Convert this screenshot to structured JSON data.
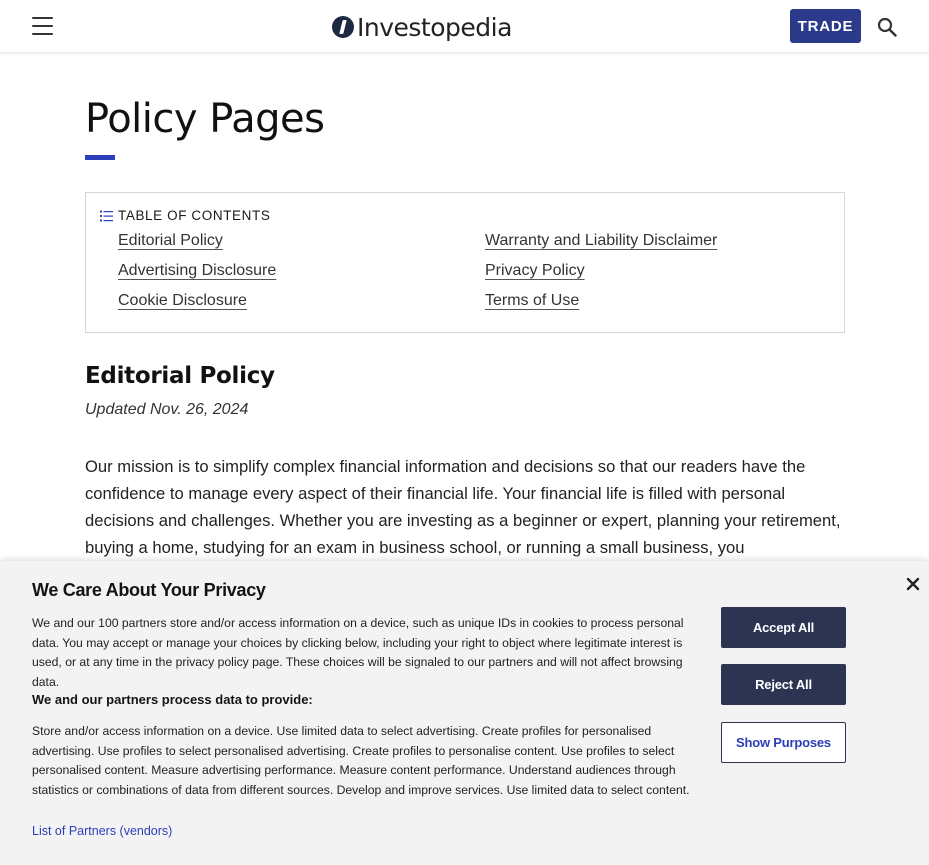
{
  "header": {
    "logo_text": "Investopedia",
    "trade_label": "TRADE",
    "brand_color": "#2c3a8c",
    "icons": [
      "menu-icon",
      "search-icon"
    ]
  },
  "main": {
    "page_title": "Policy Pages",
    "toc": {
      "heading": "TABLE OF CONTENTS",
      "left_links": [
        "Editorial Policy",
        "Advertising Disclosure",
        "Cookie Disclosure"
      ],
      "right_links": [
        "Warranty and Liability Disclaimer",
        "Privacy Policy",
        "Terms of Use"
      ]
    },
    "section_title": "Editorial Policy",
    "updated": "Updated Nov. 26, 2024",
    "paragraph": "Our mission is to simplify complex financial information and decisions so that our readers have the confidence to manage every aspect of their financial life. Your financial life is filled with personal decisions and challenges. Whether you are investing as a beginner or expert, planning your retirement, buying a home, studying for an exam in business school, or running a small business, you"
  },
  "consent": {
    "title": "We Care About Your Privacy",
    "intro": "We and our 100 partners store and/or access information on a device, such as unique IDs in cookies to process personal data. You may accept or manage your choices by clicking below, including your right to object where legitimate interest is used, or at any time in the privacy policy page. These choices will be signaled to our partners and will not affect browsing data.",
    "subheading": "We and our partners process data to provide:",
    "purposes": "Store and/or access information on a device. Use limited data to select advertising. Create profiles for personalised advertising. Use profiles to select personalised advertising. Create profiles to personalise content. Use profiles to select personalised content. Measure advertising performance. Measure content performance. Understand audiences through statistics or combinations of data from different sources. Develop and improve services. Use limited data to select content.",
    "partners_link": "List of Partners (vendors)",
    "accept_label": "Accept All",
    "reject_label": "Reject All",
    "show_purposes_label": "Show Purposes"
  }
}
